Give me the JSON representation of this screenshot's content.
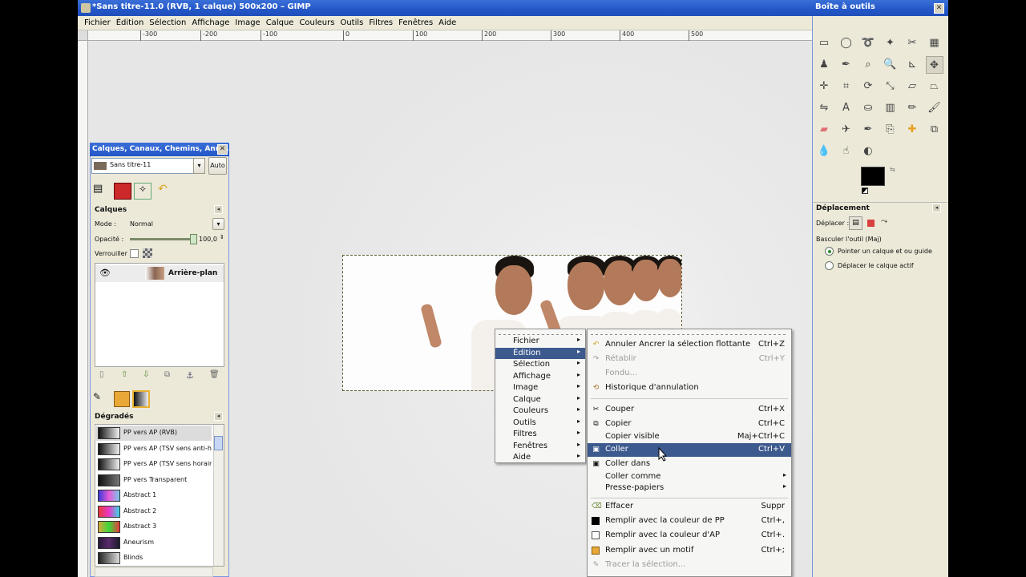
{
  "window": {
    "title": "*Sans titre-11.0 (RVB, 1 calque) 500x200 – GIMP"
  },
  "menubar": [
    "Fichier",
    "Édition",
    "Sélection",
    "Affichage",
    "Image",
    "Calque",
    "Couleurs",
    "Outils",
    "Filtres",
    "Fenêtres",
    "Aide"
  ],
  "ruler": [
    "-300",
    "-200",
    "-100",
    "0",
    "100",
    "200",
    "300",
    "400",
    "500"
  ],
  "dock": {
    "title": "Calques, Canaux, Chemins, Ann...",
    "image_combo": "Sans titre-11",
    "auto_button": "Auto",
    "layers_header": "Calques",
    "mode_label": "Mode :",
    "mode_value": "Normal",
    "opacity_label": "Opacité :",
    "opacity_value": "100,0",
    "opacity_level_percent": 100,
    "lock_label": "Verrouiller :",
    "layer_name": "Arrière-plan",
    "gradients_header": "Dégradés",
    "gradients": [
      {
        "name": "PP vers AP (RVB)",
        "colors": [
          "#111111",
          "#f2f2f2"
        ]
      },
      {
        "name": "PP vers AP (TSV sens anti-horaire)",
        "colors": [
          "#111111",
          "#f2f2f2"
        ]
      },
      {
        "name": "PP vers AP (TSV sens horaire)",
        "colors": [
          "#111111",
          "#f2f2f2"
        ]
      },
      {
        "name": "PP vers Transparent",
        "colors": [
          "#111111",
          "#777777"
        ]
      },
      {
        "name": "Abstract 1",
        "colors": [
          "#3a3ad8",
          "#e85ad8",
          "#7ac8e8"
        ]
      },
      {
        "name": "Abstract 2",
        "colors": [
          "#e83a3a",
          "#e83ac8",
          "#3ad8e8"
        ]
      },
      {
        "name": "Abstract 3",
        "colors": [
          "#d8a83a",
          "#3ad83a",
          "#e83a3a"
        ]
      },
      {
        "name": "Aneurism",
        "colors": [
          "#2a1a3a",
          "#5a2a6a",
          "#1a1a2a"
        ]
      },
      {
        "name": "Blinds",
        "colors": [
          "#222222",
          "#dddddd"
        ]
      }
    ]
  },
  "toolbox": {
    "title": "Boîte à outils",
    "tool_options_header": "Déplacement",
    "move_label": "Déplacer :",
    "switch_label": "Basculer l'outil  (Maj)",
    "option_1": "Pointer un calque et ou guide",
    "option_2": "Déplacer le calque actif",
    "fg_color": "#000000",
    "bg_color": "#ffffff"
  },
  "context_menu": {
    "items": [
      "Fichier",
      "Édition",
      "Sélection",
      "Affichage",
      "Image",
      "Calque",
      "Couleurs",
      "Outils",
      "Filtres",
      "Fenêtres",
      "Aide"
    ],
    "highlighted": "Édition"
  },
  "edit_submenu": {
    "undo": {
      "label": "Annuler Ancrer la sélection flottante",
      "shortcut": "Ctrl+Z"
    },
    "redo": {
      "label": "Rétablir",
      "shortcut": "Ctrl+Y"
    },
    "fade": {
      "label": "Fondu..."
    },
    "history": {
      "label": "Historique d'annulation"
    },
    "cut": {
      "label": "Couper",
      "shortcut": "Ctrl+X"
    },
    "copy": {
      "label": "Copier",
      "shortcut": "Ctrl+C"
    },
    "copy_visible": {
      "label": "Copier visible",
      "shortcut": "Maj+Ctrl+C"
    },
    "paste": {
      "label": "Coller",
      "shortcut": "Ctrl+V"
    },
    "paste_into": {
      "label": "Coller dans"
    },
    "paste_as": {
      "label": "Coller comme"
    },
    "buffers": {
      "label": "Presse-papiers"
    },
    "clear": {
      "label": "Effacer",
      "shortcut": "Suppr"
    },
    "fill_fg": {
      "label": "Remplir avec la couleur de PP",
      "shortcut": "Ctrl+,"
    },
    "fill_bg": {
      "label": "Remplir avec la couleur d'AP",
      "shortcut": "Ctrl+."
    },
    "fill_pattern": {
      "label": "Remplir avec un motif",
      "shortcut": "Ctrl+;"
    },
    "stroke": {
      "label": "Tracer la sélection..."
    }
  }
}
